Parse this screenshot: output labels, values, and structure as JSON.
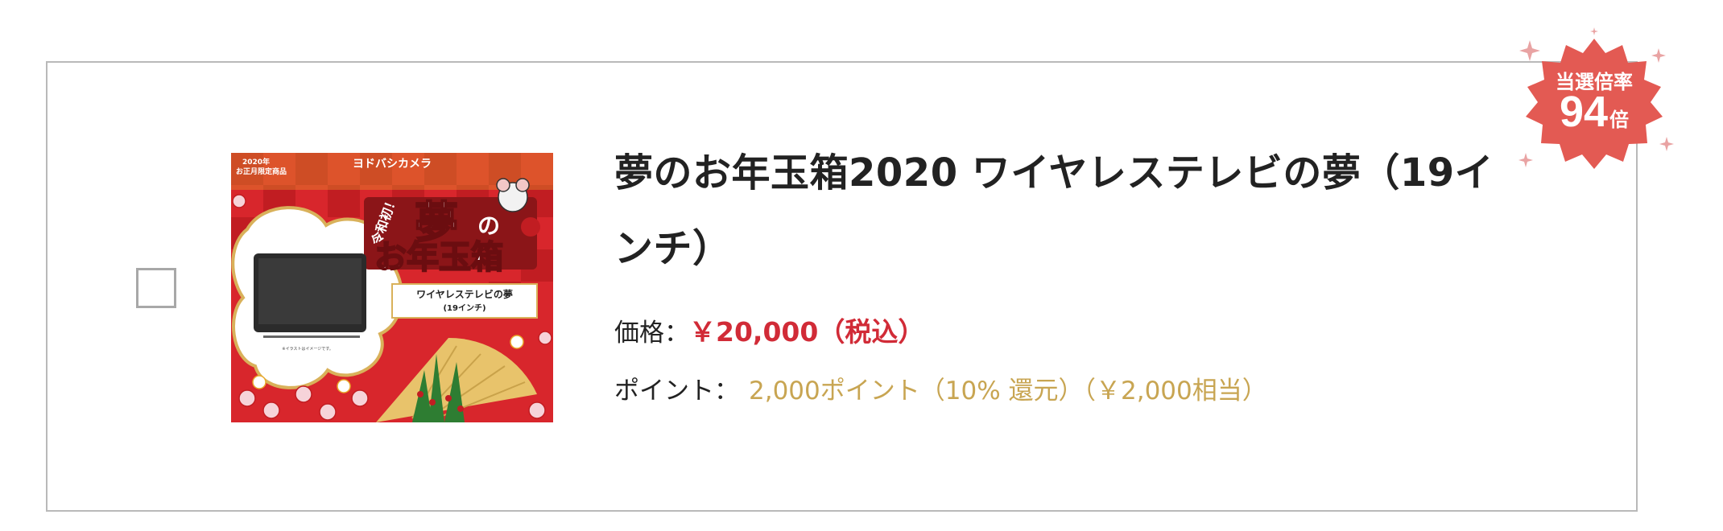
{
  "product": {
    "title": "夢のお年玉箱2020 ワイヤレステレビの夢（19インチ）",
    "price_label": "価格：",
    "price_value": "￥20,000（税込）",
    "points_label": "ポイント：",
    "points_value": "2,000ポイント（10% 還元）（￥2,000相当）"
  },
  "image": {
    "store_brand": "ヨドバシカメラ",
    "year_label": "2020年",
    "limited_label": "お正月限定商品",
    "reiwa_label": "令和初！",
    "headline_1": "夢",
    "headline_2": "の",
    "headline_3": "お年玉箱",
    "caption_line1": "ワイヤレステレビの夢",
    "caption_line2": "(19インチ)",
    "note": "※イラストはイメージです。"
  },
  "badge": {
    "label": "当選倍率",
    "value": "94",
    "unit": "倍"
  },
  "colors": {
    "price": "#d12b37",
    "points": "#c8a552",
    "badge": "#e35a53",
    "border": "#b9b9b9"
  }
}
